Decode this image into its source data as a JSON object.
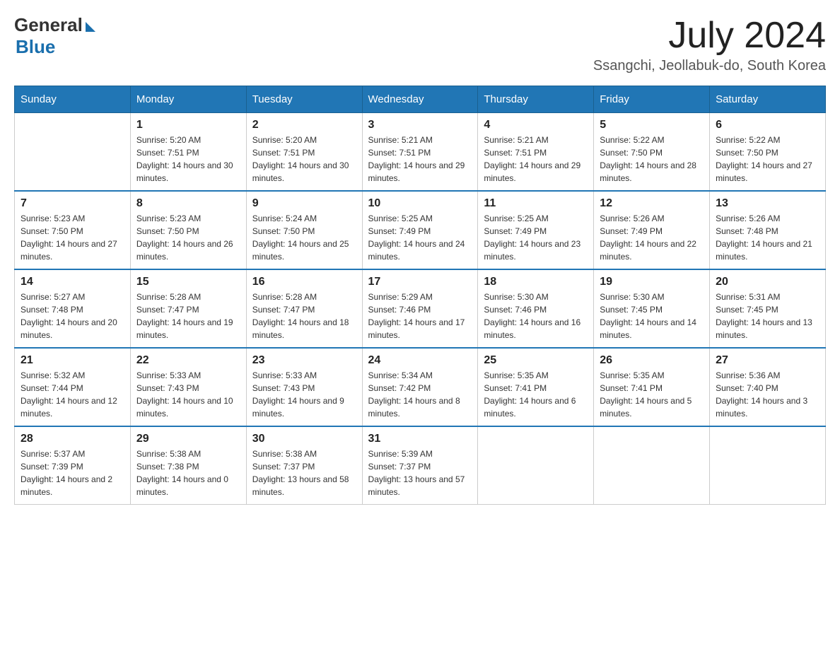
{
  "logo": {
    "general": "General",
    "blue": "Blue"
  },
  "header": {
    "month_year": "July 2024",
    "location": "Ssangchi, Jeollabuk-do, South Korea"
  },
  "weekdays": [
    "Sunday",
    "Monday",
    "Tuesday",
    "Wednesday",
    "Thursday",
    "Friday",
    "Saturday"
  ],
  "weeks": [
    [
      {
        "day": "",
        "sunrise": "",
        "sunset": "",
        "daylight": ""
      },
      {
        "day": "1",
        "sunrise": "Sunrise: 5:20 AM",
        "sunset": "Sunset: 7:51 PM",
        "daylight": "Daylight: 14 hours and 30 minutes."
      },
      {
        "day": "2",
        "sunrise": "Sunrise: 5:20 AM",
        "sunset": "Sunset: 7:51 PM",
        "daylight": "Daylight: 14 hours and 30 minutes."
      },
      {
        "day": "3",
        "sunrise": "Sunrise: 5:21 AM",
        "sunset": "Sunset: 7:51 PM",
        "daylight": "Daylight: 14 hours and 29 minutes."
      },
      {
        "day": "4",
        "sunrise": "Sunrise: 5:21 AM",
        "sunset": "Sunset: 7:51 PM",
        "daylight": "Daylight: 14 hours and 29 minutes."
      },
      {
        "day": "5",
        "sunrise": "Sunrise: 5:22 AM",
        "sunset": "Sunset: 7:50 PM",
        "daylight": "Daylight: 14 hours and 28 minutes."
      },
      {
        "day": "6",
        "sunrise": "Sunrise: 5:22 AM",
        "sunset": "Sunset: 7:50 PM",
        "daylight": "Daylight: 14 hours and 27 minutes."
      }
    ],
    [
      {
        "day": "7",
        "sunrise": "Sunrise: 5:23 AM",
        "sunset": "Sunset: 7:50 PM",
        "daylight": "Daylight: 14 hours and 27 minutes."
      },
      {
        "day": "8",
        "sunrise": "Sunrise: 5:23 AM",
        "sunset": "Sunset: 7:50 PM",
        "daylight": "Daylight: 14 hours and 26 minutes."
      },
      {
        "day": "9",
        "sunrise": "Sunrise: 5:24 AM",
        "sunset": "Sunset: 7:50 PM",
        "daylight": "Daylight: 14 hours and 25 minutes."
      },
      {
        "day": "10",
        "sunrise": "Sunrise: 5:25 AM",
        "sunset": "Sunset: 7:49 PM",
        "daylight": "Daylight: 14 hours and 24 minutes."
      },
      {
        "day": "11",
        "sunrise": "Sunrise: 5:25 AM",
        "sunset": "Sunset: 7:49 PM",
        "daylight": "Daylight: 14 hours and 23 minutes."
      },
      {
        "day": "12",
        "sunrise": "Sunrise: 5:26 AM",
        "sunset": "Sunset: 7:49 PM",
        "daylight": "Daylight: 14 hours and 22 minutes."
      },
      {
        "day": "13",
        "sunrise": "Sunrise: 5:26 AM",
        "sunset": "Sunset: 7:48 PM",
        "daylight": "Daylight: 14 hours and 21 minutes."
      }
    ],
    [
      {
        "day": "14",
        "sunrise": "Sunrise: 5:27 AM",
        "sunset": "Sunset: 7:48 PM",
        "daylight": "Daylight: 14 hours and 20 minutes."
      },
      {
        "day": "15",
        "sunrise": "Sunrise: 5:28 AM",
        "sunset": "Sunset: 7:47 PM",
        "daylight": "Daylight: 14 hours and 19 minutes."
      },
      {
        "day": "16",
        "sunrise": "Sunrise: 5:28 AM",
        "sunset": "Sunset: 7:47 PM",
        "daylight": "Daylight: 14 hours and 18 minutes."
      },
      {
        "day": "17",
        "sunrise": "Sunrise: 5:29 AM",
        "sunset": "Sunset: 7:46 PM",
        "daylight": "Daylight: 14 hours and 17 minutes."
      },
      {
        "day": "18",
        "sunrise": "Sunrise: 5:30 AM",
        "sunset": "Sunset: 7:46 PM",
        "daylight": "Daylight: 14 hours and 16 minutes."
      },
      {
        "day": "19",
        "sunrise": "Sunrise: 5:30 AM",
        "sunset": "Sunset: 7:45 PM",
        "daylight": "Daylight: 14 hours and 14 minutes."
      },
      {
        "day": "20",
        "sunrise": "Sunrise: 5:31 AM",
        "sunset": "Sunset: 7:45 PM",
        "daylight": "Daylight: 14 hours and 13 minutes."
      }
    ],
    [
      {
        "day": "21",
        "sunrise": "Sunrise: 5:32 AM",
        "sunset": "Sunset: 7:44 PM",
        "daylight": "Daylight: 14 hours and 12 minutes."
      },
      {
        "day": "22",
        "sunrise": "Sunrise: 5:33 AM",
        "sunset": "Sunset: 7:43 PM",
        "daylight": "Daylight: 14 hours and 10 minutes."
      },
      {
        "day": "23",
        "sunrise": "Sunrise: 5:33 AM",
        "sunset": "Sunset: 7:43 PM",
        "daylight": "Daylight: 14 hours and 9 minutes."
      },
      {
        "day": "24",
        "sunrise": "Sunrise: 5:34 AM",
        "sunset": "Sunset: 7:42 PM",
        "daylight": "Daylight: 14 hours and 8 minutes."
      },
      {
        "day": "25",
        "sunrise": "Sunrise: 5:35 AM",
        "sunset": "Sunset: 7:41 PM",
        "daylight": "Daylight: 14 hours and 6 minutes."
      },
      {
        "day": "26",
        "sunrise": "Sunrise: 5:35 AM",
        "sunset": "Sunset: 7:41 PM",
        "daylight": "Daylight: 14 hours and 5 minutes."
      },
      {
        "day": "27",
        "sunrise": "Sunrise: 5:36 AM",
        "sunset": "Sunset: 7:40 PM",
        "daylight": "Daylight: 14 hours and 3 minutes."
      }
    ],
    [
      {
        "day": "28",
        "sunrise": "Sunrise: 5:37 AM",
        "sunset": "Sunset: 7:39 PM",
        "daylight": "Daylight: 14 hours and 2 minutes."
      },
      {
        "day": "29",
        "sunrise": "Sunrise: 5:38 AM",
        "sunset": "Sunset: 7:38 PM",
        "daylight": "Daylight: 14 hours and 0 minutes."
      },
      {
        "day": "30",
        "sunrise": "Sunrise: 5:38 AM",
        "sunset": "Sunset: 7:37 PM",
        "daylight": "Daylight: 13 hours and 58 minutes."
      },
      {
        "day": "31",
        "sunrise": "Sunrise: 5:39 AM",
        "sunset": "Sunset: 7:37 PM",
        "daylight": "Daylight: 13 hours and 57 minutes."
      },
      {
        "day": "",
        "sunrise": "",
        "sunset": "",
        "daylight": ""
      },
      {
        "day": "",
        "sunrise": "",
        "sunset": "",
        "daylight": ""
      },
      {
        "day": "",
        "sunrise": "",
        "sunset": "",
        "daylight": ""
      }
    ]
  ]
}
